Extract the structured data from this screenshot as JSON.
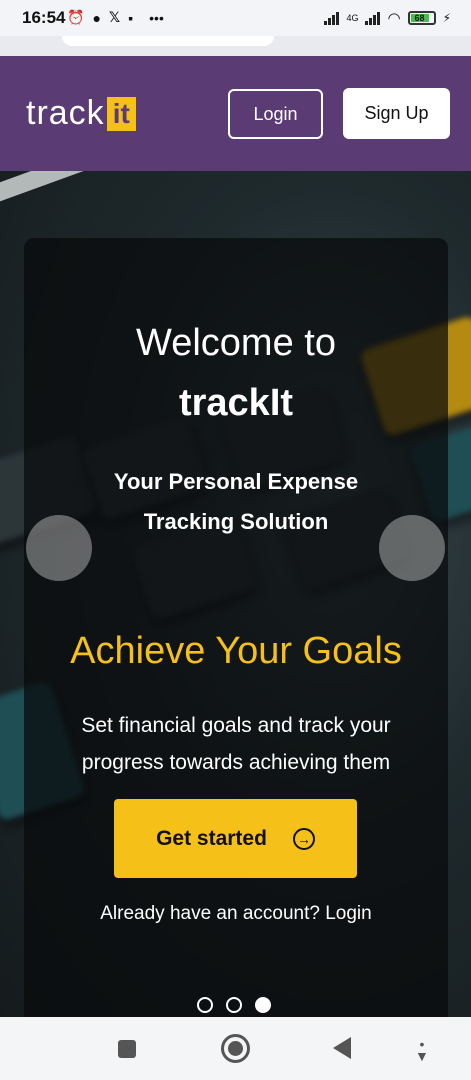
{
  "status_bar": {
    "time": "16:54",
    "network_label": "4G",
    "battery_level": "68"
  },
  "header": {
    "logo_track": "track",
    "logo_it": "it",
    "login_label": "Login",
    "signup_label": "Sign Up"
  },
  "hero": {
    "welcome": "Welcome to",
    "brand": "trackIt",
    "tagline": "Your Personal Expense Tracking Solution",
    "slide_title": "Achieve Your Goals",
    "slide_description": "Set financial goals and track your progress towards achieving them",
    "cta_label": "Get started",
    "account_prompt": "Already have an account? Login",
    "slides_total": 3,
    "active_slide": 3
  },
  "colors": {
    "header_bg": "#5a3b74",
    "accent": "#f5c018"
  },
  "icons": {
    "cta": "arrow-right-circle-icon",
    "carousel_prev": "carousel-prev-icon",
    "carousel_next": "carousel-next-icon",
    "nav_recents": "square-icon",
    "nav_home": "home-circle-icon",
    "nav_back": "back-triangle-icon",
    "nav_menu": "menu-down-icon"
  }
}
